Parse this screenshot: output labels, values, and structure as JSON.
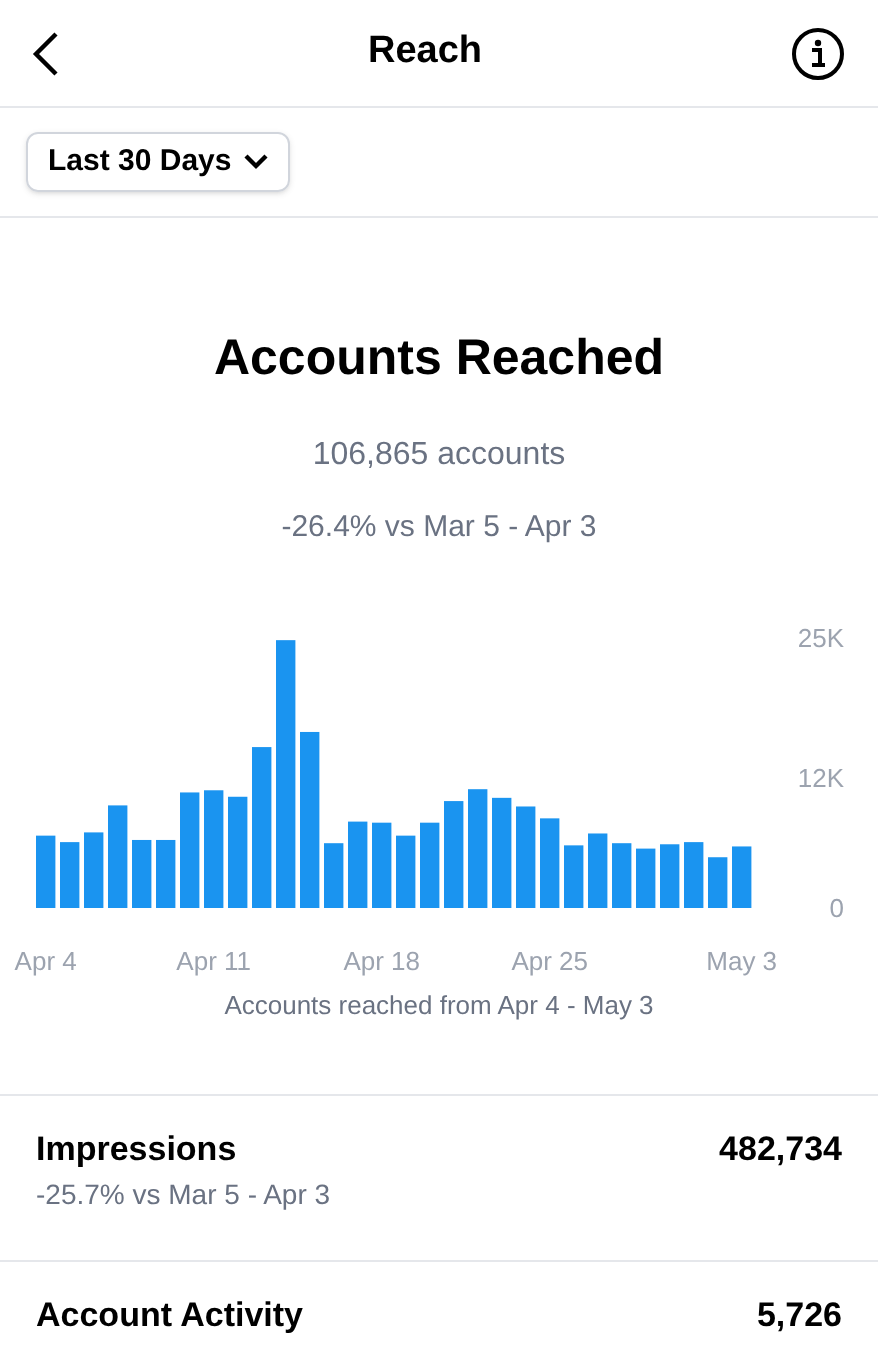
{
  "header": {
    "title": "Reach"
  },
  "filter": {
    "label": "Last 30 Days"
  },
  "summary": {
    "title": "Accounts Reached",
    "count": "106,865 accounts",
    "change": "-26.4% vs Mar 5 - Apr 3"
  },
  "chart_data": {
    "type": "bar",
    "title": "Accounts reached from Apr 4 - May 3",
    "categories": [
      "Apr 4",
      null,
      null,
      null,
      null,
      null,
      null,
      "Apr 11",
      null,
      null,
      null,
      null,
      null,
      null,
      "Apr 18",
      null,
      null,
      null,
      null,
      null,
      null,
      "Apr 25",
      null,
      null,
      null,
      null,
      null,
      null,
      null,
      "May 3"
    ],
    "series": [
      {
        "color": "#1a94f0",
        "values": [
          6700,
          6100,
          7000,
          9500,
          6300,
          6300,
          10700,
          10900,
          10300,
          14900,
          24800,
          16300,
          6000,
          8000,
          7900,
          6700,
          7900,
          9900,
          11000,
          10200,
          9400,
          8300,
          5800,
          6900,
          6000,
          5500,
          5900,
          6100,
          4700,
          5700
        ]
      }
    ],
    "ylim": [
      0,
      25000
    ],
    "yticks": [
      {
        "value": 0,
        "label": "0"
      },
      {
        "value": 12000,
        "label": "12K"
      },
      {
        "value": 25000,
        "label": "25K"
      }
    ]
  },
  "metrics": [
    {
      "label": "Impressions",
      "value": "482,734",
      "change": "-25.7% vs Mar 5 - Apr 3"
    },
    {
      "label": "Account Activity",
      "value": "5,726"
    }
  ]
}
